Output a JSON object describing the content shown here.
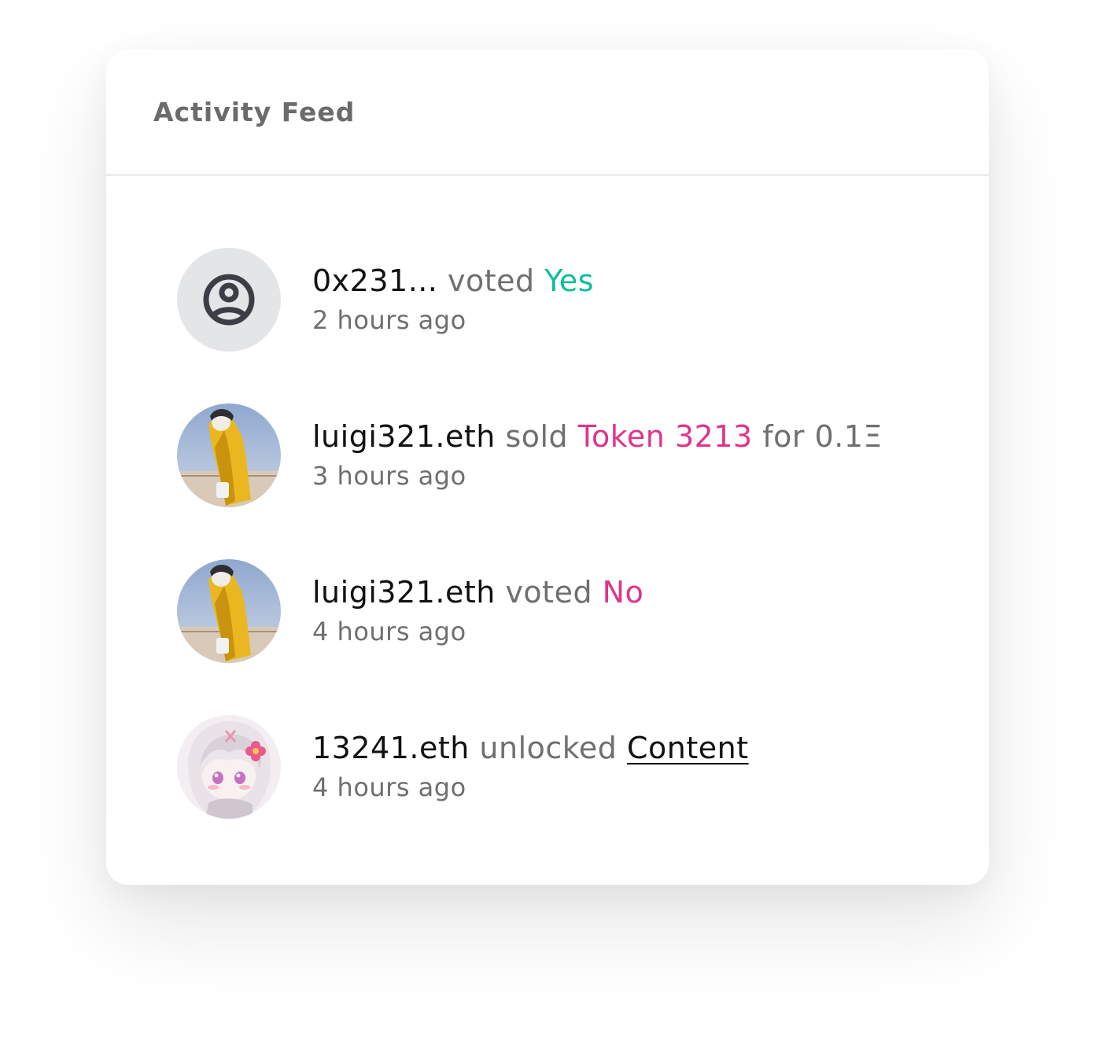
{
  "header": {
    "title": "Activity Feed"
  },
  "feed": {
    "items": [
      {
        "avatar_icon": "user-circle-icon",
        "actor": "0x231...",
        "action": " voted ",
        "object": "Yes",
        "object_color": "#0fbe9c",
        "suffix": "",
        "time": "2 hours ago"
      },
      {
        "avatar_icon": "avatar-yellow-raincoat",
        "actor": "luigi321.eth",
        "action": " sold ",
        "object": "Token 3213",
        "object_color": "#e0348a",
        "suffix": " for 0.1Ξ",
        "time": "3 hours ago"
      },
      {
        "avatar_icon": "avatar-yellow-raincoat",
        "actor": "luigi321.eth",
        "action": " voted ",
        "object": "No",
        "object_color": "#e0348a",
        "suffix": "",
        "time": "4 hours ago"
      },
      {
        "avatar_icon": "avatar-anime-girl",
        "actor": "13241.eth",
        "action": " unlocked ",
        "object": "Content",
        "object_color": "#111111",
        "suffix": "",
        "time": "4 hours ago"
      }
    ]
  }
}
